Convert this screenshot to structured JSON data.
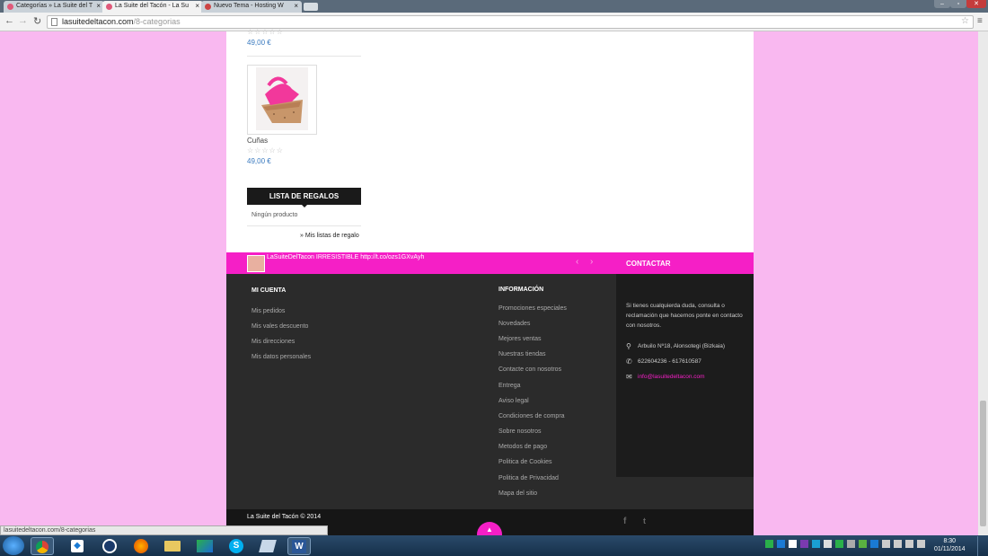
{
  "browser": {
    "tabs": [
      {
        "label": "Categorías » La Suite del T"
      },
      {
        "label": "La Suite del Tacón - La Su"
      },
      {
        "label": "Nuevo Tema - Hosting W"
      }
    ],
    "url_host": "lasuitedeltacon.com",
    "url_path": "/8-categorias",
    "status_url": "lasuitedeltacon.com/8-categorias"
  },
  "products": [
    {
      "price": "49,00 €"
    },
    {
      "name": "Cuñas",
      "price": "49,00 €"
    }
  ],
  "gift": {
    "title": "LISTA DE REGALOS",
    "empty": "Ningún producto",
    "more": "» Mis listas de regalo"
  },
  "tweet": {
    "text": "LaSuiteDelTacon IRRESISTIBLE http://t.co/ozs1GXvAyh"
  },
  "contact": {
    "title": "CONTACTAR",
    "intro": "Si tienes cualquierda duda, consulta o reclamación que hacernos ponte en contacto con nosotros.",
    "address": "Arbuilo Nº18, Alonsotegi (Bizkaia)",
    "phone": "622604236 - 617610587",
    "email": "info@lasuitedeltacon.com"
  },
  "account": {
    "title": "MI CUENTA",
    "links": [
      "Mis pedidos",
      "Mis vales descuento",
      "Mis direcciones",
      "Mis datos personales"
    ]
  },
  "info": {
    "title": "INFORMACIÓN",
    "links": [
      "Promociones especiales",
      "Novedades",
      "Mejores ventas",
      "Nuestras tiendas",
      "Contacte con nosotros",
      "Entrega",
      "Aviso legal",
      "Condiciones de compra",
      "Sobre nosotros",
      "Metodos de pago",
      "Politica de Cookies",
      "Politica de Privacidad",
      "Mapa del sitio"
    ]
  },
  "footer": {
    "copyright": "La Suite del Tacón © 2014"
  },
  "clock": {
    "time": "8:30",
    "date": "01/11/2014"
  },
  "colors": {
    "brand_pink": "#f51fc6",
    "page_bg": "#f9b8f0",
    "footer_dark": "#2b2b2b"
  }
}
